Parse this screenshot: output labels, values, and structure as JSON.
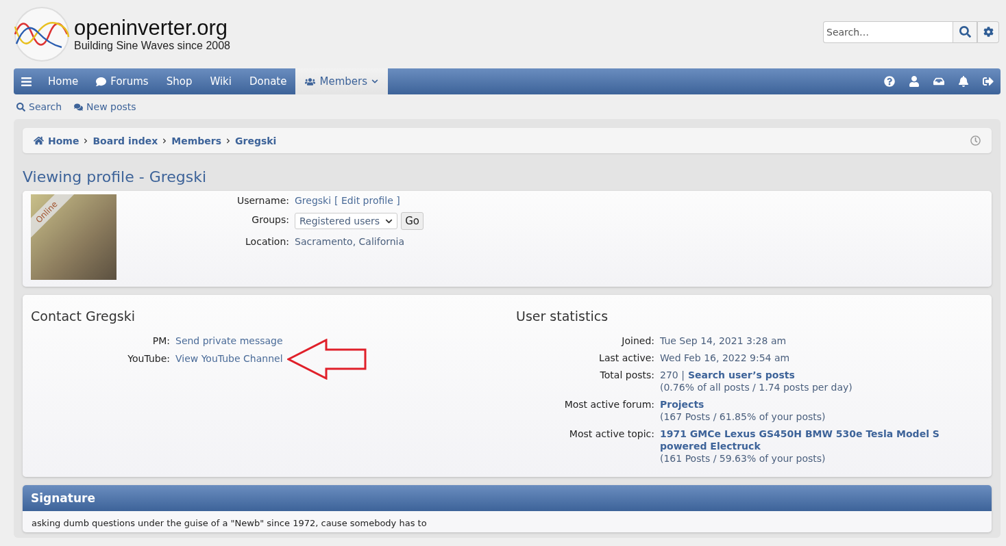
{
  "header": {
    "site_name": "openinverter.org",
    "tagline": "Building Sine Waves since 2008",
    "search": {
      "placeholder": "Search…"
    }
  },
  "navbar": {
    "items": [
      {
        "label": "Home",
        "selected": false,
        "dropdown": false
      },
      {
        "label": "Forums",
        "selected": false,
        "dropdown": false
      },
      {
        "label": "Shop",
        "selected": false,
        "dropdown": false
      },
      {
        "label": "Wiki",
        "selected": false,
        "dropdown": false
      },
      {
        "label": "Donate",
        "selected": false,
        "dropdown": false
      },
      {
        "label": "Members",
        "selected": true,
        "dropdown": true
      }
    ]
  },
  "quick_links": [
    "Search",
    "New posts"
  ],
  "breadcrumbs": [
    "Home",
    "Board index",
    "Members",
    "Gregski"
  ],
  "page_title": "Viewing profile - Gregski",
  "profile": {
    "status_badge": "Online",
    "username_label": "Username:",
    "username": "Gregski",
    "edit_link": "[ Edit profile ]",
    "groups_label": "Groups:",
    "groups_select": "Registered users",
    "go_button": "Go",
    "location_label": "Location:",
    "location": "Sacramento, California"
  },
  "contact": {
    "title": "Contact Gregski",
    "rows": [
      {
        "label": "PM:",
        "value": "Send private message"
      },
      {
        "label": "YouTube:",
        "value": "View YouTube Channel"
      }
    ]
  },
  "statistics": {
    "title": "User statistics",
    "rows": [
      {
        "label": "Joined:",
        "value": "Tue Sep 14, 2021 3:28 am"
      },
      {
        "label": "Last active:",
        "value": "Wed Feb 16, 2022 9:54 am"
      },
      {
        "label": "Total posts:",
        "value": "270 |",
        "link": "Search user’s posts",
        "note": "(0.76% of all posts / 1.74 posts per day)"
      },
      {
        "label": "Most active forum:",
        "link": "Projects",
        "note": "(167 Posts / 61.85% of your posts)"
      },
      {
        "label": "Most active topic:",
        "link": "1971 GMCe Lexus GS450H BMW 530e Tesla Model S powered Electruck",
        "note": "(161 Posts / 59.63% of your posts)"
      }
    ]
  },
  "signature": {
    "title": "Signature",
    "text": "asking dumb questions under the guise of a \"Newb\" since 1972, cause somebody has to"
  }
}
